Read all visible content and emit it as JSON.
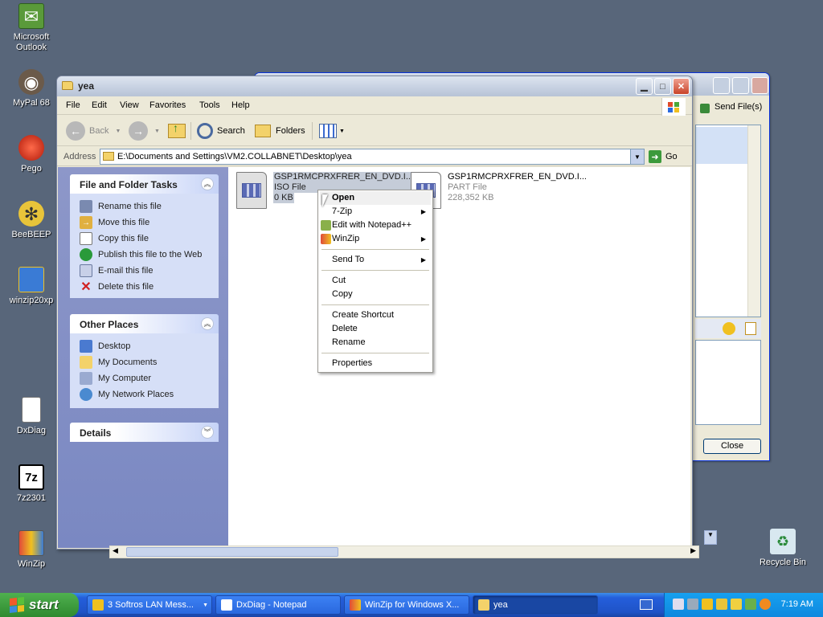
{
  "desktop": {
    "icons": [
      {
        "label": "Microsoft\nOutlook",
        "l1": "Microsoft",
        "l2": "Outlook"
      },
      {
        "l1": "MyPal 68"
      },
      {
        "l1": "Pego"
      },
      {
        "l1": "BeeBEEP"
      },
      {
        "l1": "winzip20xp"
      },
      {
        "l1": "DxDiag"
      },
      {
        "l1": "7z2301"
      },
      {
        "l1": "WinZip"
      },
      {
        "l1": "Recycle Bin"
      }
    ]
  },
  "bg_window": {
    "send_files": "Send File(s)",
    "close": "Close"
  },
  "explorer": {
    "title": "yea",
    "menu": [
      "File",
      "Edit",
      "View",
      "Favorites",
      "Tools",
      "Help"
    ],
    "toolbar": {
      "back": "Back",
      "search": "Search",
      "folders": "Folders"
    },
    "address": {
      "label": "Address",
      "value": "E:\\Documents and Settings\\VM2.COLLABNET\\Desktop\\yea",
      "go": "Go"
    },
    "file_tasks": {
      "title": "File and Folder Tasks",
      "items": [
        "Rename this file",
        "Move this file",
        "Copy this file",
        "Publish this file to the Web",
        "E-mail this file",
        "Delete this file"
      ]
    },
    "other_places": {
      "title": "Other Places",
      "items": [
        "Desktop",
        "My Documents",
        "My Computer",
        "My Network Places"
      ]
    },
    "details": {
      "title": "Details"
    },
    "files": [
      {
        "name": "GSP1RMCPRXFRER_EN_DVD.I...",
        "type": "ISO File",
        "size": "0 KB"
      },
      {
        "name": "GSP1RMCPRXFRER_EN_DVD.I...",
        "type": "PART File",
        "size": "228,352 KB"
      }
    ]
  },
  "context_menu": {
    "open": "Open",
    "zip7": "7-Zip",
    "notepad": "Edit with Notepad++",
    "winzip": "WinZip",
    "sendto": "Send To",
    "cut": "Cut",
    "copy": "Copy",
    "shortcut": "Create Shortcut",
    "delete": "Delete",
    "rename": "Rename",
    "properties": "Properties"
  },
  "taskbar": {
    "start": "start",
    "items": [
      {
        "label": "3 Softros LAN Mess..."
      },
      {
        "label": "DxDiag - Notepad"
      },
      {
        "label": "WinZip for Windows X..."
      },
      {
        "label": "yea"
      }
    ],
    "clock": "7:19 AM"
  }
}
